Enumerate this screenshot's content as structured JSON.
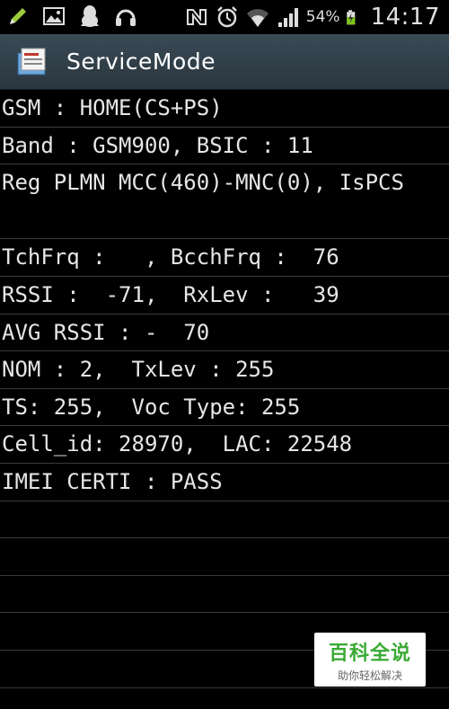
{
  "status_bar": {
    "icons_left": [
      "pencil-icon",
      "image-icon",
      "qq-penguin-icon",
      "headset-icon"
    ],
    "icons_right": [
      "nfc-icon",
      "alarm-icon",
      "wifi-icon",
      "signal-icon",
      "battery-charging-icon"
    ],
    "battery_percent": "54%",
    "time": "14:17"
  },
  "title_bar": {
    "title": "ServiceMode"
  },
  "rows": [
    "GSM : HOME(CS+PS)",
    "Band : GSM900, BSIC : 11",
    "Reg PLMN MCC(460)-MNC(0), IsPCS",
    "TchFrq :   , BcchFrq :  76",
    "RSSI :  -71,  RxLev :   39",
    "AVG RSSI : -  70",
    "NOM : 2,  TxLev : 255",
    "TS: 255,  Voc Type: 255",
    "Cell_id: 28970,  LAC: 22548",
    "IMEI CERTI : PASS",
    "",
    "",
    "",
    "",
    ""
  ],
  "watermark": {
    "title": "百科全说",
    "subtitle": "助你轻松解决"
  },
  "colors": {
    "background": "#000000",
    "title_bar": "#2f3c45",
    "text": "#e6e6e6",
    "divider": "#3a3a3a",
    "watermark_green": "#3aaa35"
  }
}
